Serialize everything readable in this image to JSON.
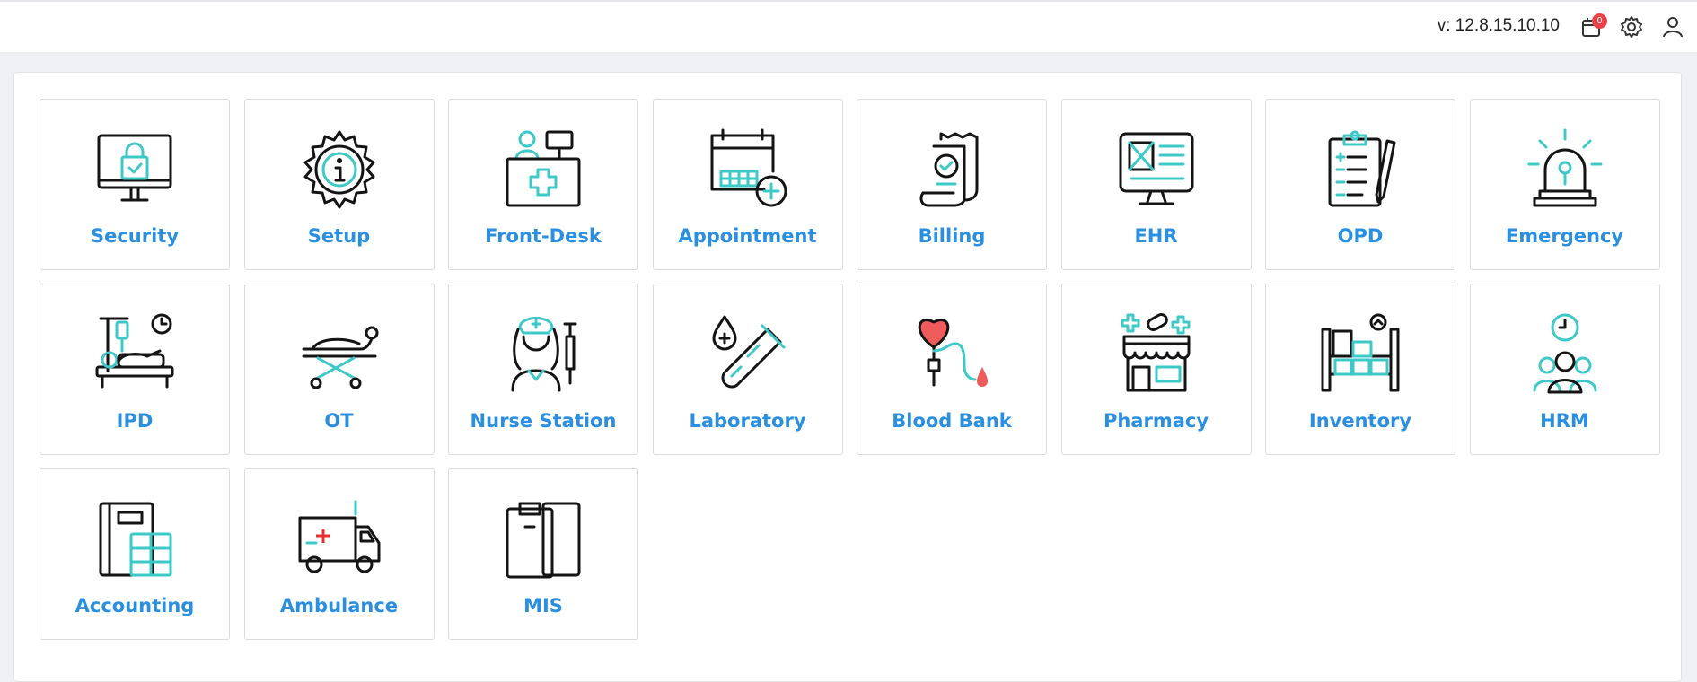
{
  "header": {
    "version": "v: 12.8.15.10.10",
    "notification_count": "0",
    "icons": [
      "calendar-icon",
      "gear-icon",
      "user-icon"
    ]
  },
  "colors": {
    "label": "#2b8fe0",
    "accent": "#3fc8c8",
    "badge": "#e9434a"
  },
  "modules": [
    {
      "label": "Security",
      "icon": "monitor-lock-icon"
    },
    {
      "label": "Setup",
      "icon": "gear-info-icon"
    },
    {
      "label": "Front-Desk",
      "icon": "reception-desk-icon"
    },
    {
      "label": "Appointment",
      "icon": "calendar-add-icon"
    },
    {
      "label": "Billing",
      "icon": "receipt-icon"
    },
    {
      "label": "EHR",
      "icon": "monitor-record-icon"
    },
    {
      "label": "OPD",
      "icon": "clipboard-pen-icon"
    },
    {
      "label": "Emergency",
      "icon": "siren-icon"
    },
    {
      "label": "IPD",
      "icon": "hospital-bed-icon"
    },
    {
      "label": "OT",
      "icon": "stretcher-icon"
    },
    {
      "label": "Nurse Station",
      "icon": "nurse-syringe-icon"
    },
    {
      "label": "Laboratory",
      "icon": "test-tube-icon"
    },
    {
      "label": "Blood Bank",
      "icon": "blood-bag-icon"
    },
    {
      "label": "Pharmacy",
      "icon": "pharmacy-store-icon"
    },
    {
      "label": "Inventory",
      "icon": "shelves-icon"
    },
    {
      "label": "HRM",
      "icon": "people-clock-icon"
    },
    {
      "label": "Accounting",
      "icon": "ledger-calculator-icon"
    },
    {
      "label": "Ambulance",
      "icon": "ambulance-icon"
    },
    {
      "label": "MIS",
      "icon": "clipboard-icon"
    }
  ]
}
